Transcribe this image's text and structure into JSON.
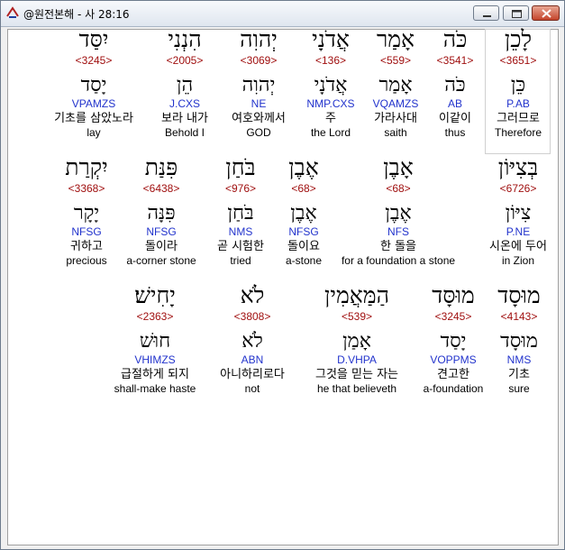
{
  "window": {
    "title": "@원전본해 - 사 28:16"
  },
  "words": [
    {
      "heb": "לָכֵן",
      "num": "<3651>",
      "root": "כֵּן",
      "code": "P.AB",
      "kor": "그러므로",
      "eng": "Therefore"
    },
    {
      "heb": "כֹּה",
      "num": "<3541>",
      "root": "כֹּה",
      "code": "AB",
      "kor": "이같이",
      "eng": "thus"
    },
    {
      "heb": "אָמַר",
      "num": "<559>",
      "root": "אָמַר",
      "code": "VQAMZS",
      "kor": "가라사대",
      "eng": "saith"
    },
    {
      "heb": "אֲדֹנָי",
      "num": "<136>",
      "root": "אֲדֹנָי",
      "code": "NMP.CXS",
      "kor": "주",
      "eng": "the Lord"
    },
    {
      "heb": "יְהוִה",
      "num": "<3069>",
      "root": "יְהוִה",
      "code": "NE",
      "kor": "여호와께서",
      "eng": "GOD"
    },
    {
      "heb": "הִנְנִי",
      "num": "<2005>",
      "root": "הֵן",
      "code": "J.CXS",
      "kor": "보라 내가",
      "eng": "Behold I"
    },
    {
      "heb": "יִסַּד",
      "num": "<3245>",
      "root": "יָסַד",
      "code": "VPAMZS",
      "kor": "기초를 삼았노라",
      "eng": "lay"
    },
    {
      "heb": "בְּצִיּוֹן",
      "num": "<6726>",
      "root": "צִיּוֹן",
      "code": "P.NE",
      "kor": "시온에 두어",
      "eng": "in Zion"
    },
    {
      "heb": "אָבֶן",
      "num": "<68>",
      "root": "אֶבֶן",
      "code": "NFS",
      "kor": "한 돌을",
      "eng": "for a foundation a stone"
    },
    {
      "heb": "אֶבֶן",
      "num": "<68>",
      "root": "אֶבֶן",
      "code": "NFSG",
      "kor": "돌이요",
      "eng": "a-stone"
    },
    {
      "heb": "בֹּחַן",
      "num": "<976>",
      "root": "בֹּחַן",
      "code": "NMS",
      "kor": "곧 시험한",
      "eng": "tried"
    },
    {
      "heb": "פִּנַּת",
      "num": "<6438>",
      "root": "פִּנָּה",
      "code": "NFSG",
      "kor": "돌이라",
      "eng": "a-corner stone"
    },
    {
      "heb": "יִקְרַת",
      "num": "<3368>",
      "root": "יָקָר",
      "code": "NFSG",
      "kor": "귀하고",
      "eng": "precious"
    },
    {
      "heb": "מוּסָד",
      "num": "<4143>",
      "root": "מוּסָד",
      "code": "NMS",
      "kor": "기초",
      "eng": "sure"
    },
    {
      "heb": "מוּסָּד",
      "num": "<3245>",
      "root": "יָסַד",
      "code": "VOPPMS",
      "kor": "견고한",
      "eng": "a-foundation"
    },
    {
      "heb": "הַמַּאֲמִין",
      "num": "<539>",
      "root": "אָמַן",
      "code": "D.VHPA",
      "kor": "그것을 믿는 자는",
      "eng": "he that believeth"
    },
    {
      "heb": "לֹא",
      "num": "<3808>",
      "root": "לֹא",
      "code": "ABN",
      "kor": "아니하리로다",
      "eng": "not"
    },
    {
      "heb": "יָחִישׁ׃",
      "num": "<2363>",
      "root": "חוּשׁ",
      "code": "VHIMZS",
      "kor": "급절하게 되지",
      "eng": "shall-make haste"
    }
  ]
}
